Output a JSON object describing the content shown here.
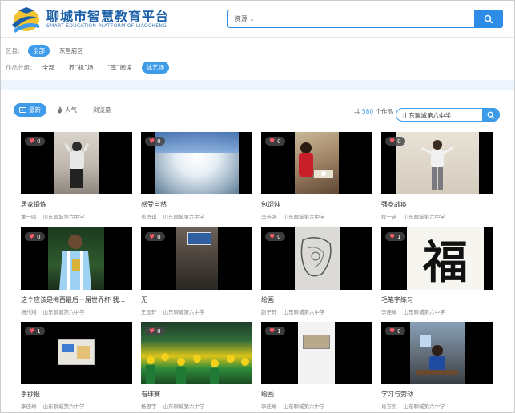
{
  "header": {
    "title": "聊城市智慧教育平台",
    "subtitle": "SMART EDUCATION PLATFORM OF LIAOCHENG",
    "search_category": "资源",
    "search_placeholder": ""
  },
  "filters": {
    "region_label": "区县：",
    "regions": [
      "全部",
      "东昌府区"
    ],
    "group_label": "作品分组：",
    "groups": [
      "全部",
      "养“机”场",
      "“享”阅读",
      "体艺场"
    ]
  },
  "toolbar": {
    "tabs": [
      "最新",
      "人气",
      "浏览量"
    ],
    "total_prefix": "共",
    "total_count": "580",
    "total_suffix": "个作品",
    "school_search_value": "山东聊城第六中学"
  },
  "colors": {
    "accent": "#3d9be9",
    "brand": "#1a5fa8",
    "heart": "#ff5a6e"
  },
  "cards": [
    {
      "title": "居家锻炼",
      "author": "董一鸣",
      "school": "山东聊城第六中学",
      "likes": "0"
    },
    {
      "title": "感受自然",
      "author": "盖思琪",
      "school": "山东聊城第六中学",
      "likes": "0"
    },
    {
      "title": "包馄饨",
      "author": "李若冰",
      "school": "山东聊城第六中学",
      "likes": "0"
    },
    {
      "title": "强身战疫",
      "author": "程一诺",
      "school": "山东聊城第六中学",
      "likes": "0"
    },
    {
      "title": "这个应该是梅西最后一届世界杯 我...",
      "author": "杨代翔",
      "school": "山东聊城第六中学",
      "likes": "0"
    },
    {
      "title": "无",
      "author": "王国轩",
      "school": "山东聊城第六中学",
      "likes": "0"
    },
    {
      "title": "绘画",
      "author": "赵子轩",
      "school": "山东聊城第六中学",
      "likes": "0"
    },
    {
      "title": "毛笔字练习",
      "author": "李佳琳",
      "school": "山东聊城第六中学",
      "likes": "1"
    },
    {
      "title": "手抄报",
      "author": "李佳琳",
      "school": "山东聊城第六中学",
      "likes": "1"
    },
    {
      "title": "看球赛",
      "author": "杨思宇",
      "school": "山东聊城第六中学",
      "likes": "0"
    },
    {
      "title": "绘画",
      "author": "李佳琳",
      "school": "山东聊城第六中学",
      "likes": "1"
    },
    {
      "title": "学习与劳动",
      "author": "肖方凯",
      "school": "山东聊城第六中学",
      "likes": "0"
    }
  ],
  "calligraphy_char": "福"
}
